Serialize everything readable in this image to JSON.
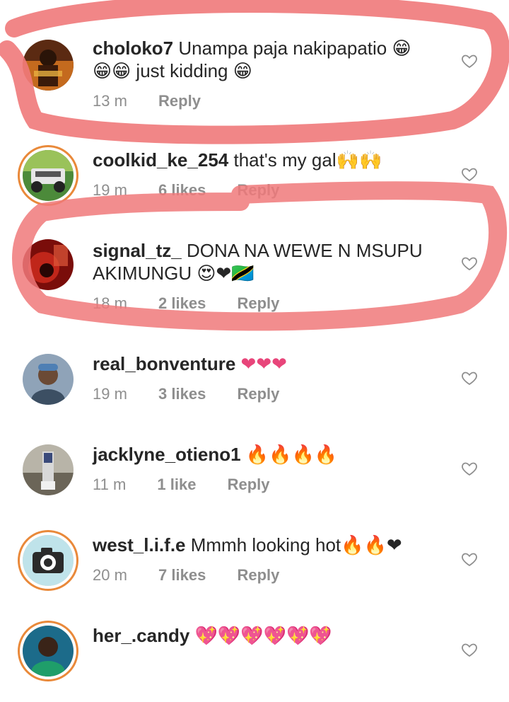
{
  "comments": [
    {
      "username": "choloko7",
      "text": "Unampa paja nakipapatio 😁",
      "text2": "😁😁 just kidding 😁",
      "time": "13 m",
      "likes": "",
      "reply": "Reply",
      "avatar_icon": "movie-poster-avatar"
    },
    {
      "username": "coolkid_ke_254",
      "text": "that's my gal🙌🙌",
      "text2": "",
      "time": "19 m",
      "likes": "6 likes",
      "reply": "Reply",
      "avatar_icon": "jeep-avatar"
    },
    {
      "username": "signal_tz_",
      "text": "DONA NA WEWE N MSUPU",
      "text2": "AKIMUNGU 😍❤🇹🇿",
      "time": "18 m",
      "likes": "2 likes",
      "reply": "Reply",
      "avatar_icon": "red-photo-avatar"
    },
    {
      "username": "real_bonventure",
      "text": "❤❤❤",
      "text2": "",
      "time": "19 m",
      "likes": "3 likes",
      "reply": "Reply",
      "avatar_icon": "person-avatar"
    },
    {
      "username": "jacklyne_otieno1",
      "text": "🔥🔥🔥🔥",
      "text2": "",
      "time": "11 m",
      "likes": "1 like",
      "reply": "Reply",
      "avatar_icon": "outdoor-avatar"
    },
    {
      "username": "west_l.i.f.e",
      "text": "Mmmh looking hot🔥🔥❤",
      "text2": "",
      "time": "20 m",
      "likes": "7 likes",
      "reply": "Reply",
      "avatar_icon": "camera-avatar"
    },
    {
      "username": "her_.candy",
      "text": "💖💖💖💖💖💖",
      "text2": "",
      "time": "",
      "likes": "",
      "reply": "",
      "avatar_icon": "person-avatar"
    }
  ],
  "colors": {
    "username": "#262626",
    "meta": "#8e8e8e",
    "highlight_marker": "#f0797a",
    "story_ring": "#e9893a"
  }
}
